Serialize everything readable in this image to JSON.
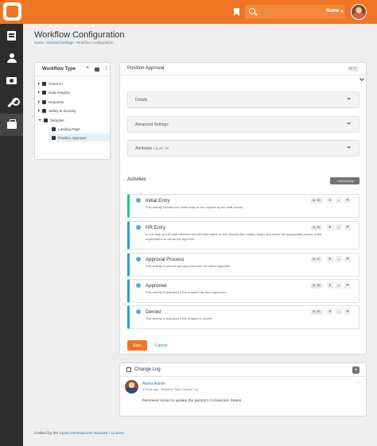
{
  "topbar": {
    "user_name": "Name"
  },
  "header": {
    "title": "Workflow Configuration",
    "breadcrumb": [
      "Home",
      "General Settings",
      "Workflow Configuration"
    ]
  },
  "workflow_types": {
    "title": "Workflow Type",
    "add_icon": "plus-icon",
    "items": [
      {
        "label": "Check-in"
      },
      {
        "label": "Data Integrity"
      },
      {
        "label": "Requests"
      },
      {
        "label": "Safety & Security"
      },
      {
        "label": "Samples"
      },
      {
        "label": "Landing Page"
      },
      {
        "label": "Position Approval"
      }
    ]
  },
  "panel": {
    "title": "Position Approval",
    "id_badge": "Id: 17",
    "sections": [
      {
        "label": "Details"
      },
      {
        "label": "Advanced Settings"
      },
      {
        "label": "Attributes",
        "sub": "Count: 10"
      }
    ],
    "activities_title": "Activities",
    "add_activity_label": "+ Add Activity",
    "activities": [
      {
        "title": "Initial Entry",
        "id": "Id: 35",
        "desc": "This activity handles the initial entry of the request by the staff person."
      },
      {
        "title": "HR Entry",
        "id": "Id: 36",
        "desc": "In this step an HR staff member will add information to the request (like salary range) and select the appropriate person in the organization to act as the approver."
      },
      {
        "title": "Approval Process",
        "id": "Id: 37",
        "desc": "This activity is used to get approval from the select approver."
      },
      {
        "title": "Approved",
        "id": "Id: 38",
        "desc": "This activity is activated if the request has been approved."
      },
      {
        "title": "Denied",
        "id": "Id: 39",
        "desc": "This activity is activated if the request is denied."
      }
    ],
    "save_label": "Save",
    "cancel_label": "Cancel"
  },
  "change_log": {
    "title": "Change Log",
    "author": "Alisha Admin",
    "time": "5 hours ago",
    "source": "Workflow Type Change Log",
    "text": "Removed Action to update the person's Connection Status."
  },
  "footer": {
    "prefix": "Crafted by the",
    "org_link": "Spark Development Network",
    "separator": "/",
    "license_link": "License"
  },
  "colors": {
    "brand": "#ee7624",
    "sidebar": "#2d2d2d",
    "active_activity": "#16c98d",
    "activity": "#2d9ad6"
  }
}
